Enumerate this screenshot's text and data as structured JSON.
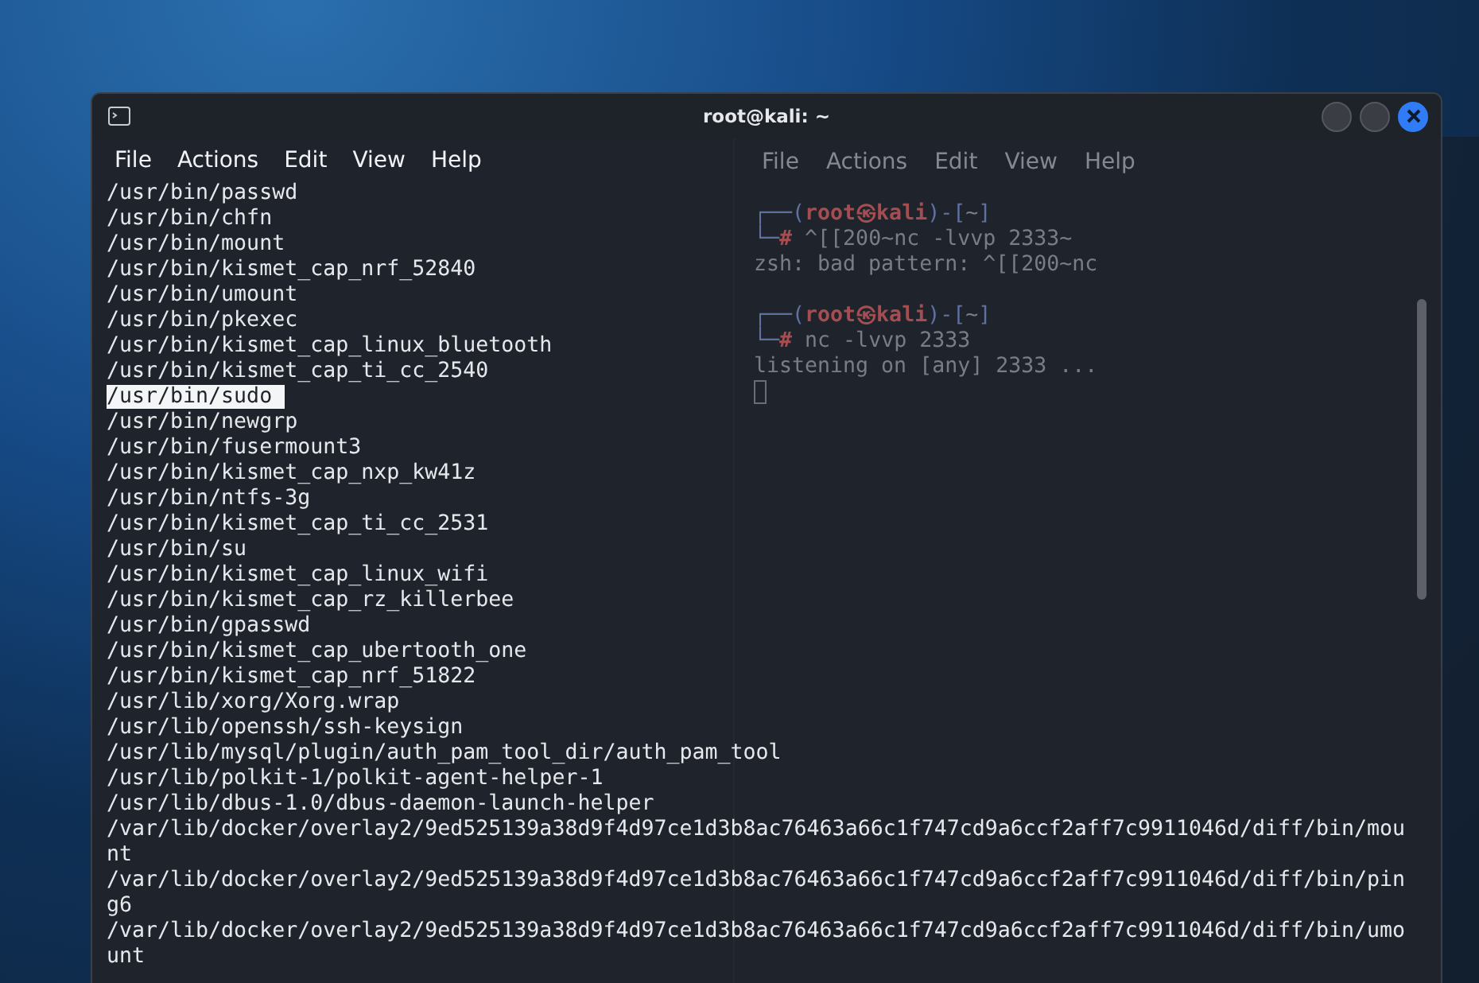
{
  "window": {
    "title": "root@kali: ~"
  },
  "menu": [
    "File",
    "Actions",
    "Edit",
    "View",
    "Help"
  ],
  "background_window": {
    "menu": [
      "File",
      "Actions",
      "Edit",
      "View",
      "Help"
    ],
    "lines": [
      {
        "parts": [
          {
            "text": "┌──(",
            "kind": "frame"
          },
          {
            "text": "root㉿kali",
            "kind": "user"
          },
          {
            "text": ")-[",
            "kind": "frame"
          },
          {
            "text": "~",
            "kind": "plain"
          },
          {
            "text": "]",
            "kind": "frame"
          }
        ]
      },
      {
        "parts": [
          {
            "text": "└─",
            "kind": "frame"
          },
          {
            "text": "#",
            "kind": "user"
          },
          {
            "text": " ^[[200~nc -lvvp 2333~",
            "kind": "plain"
          }
        ]
      },
      {
        "parts": [
          {
            "text": "zsh: bad pattern: ^[[200~nc",
            "kind": "plain"
          }
        ]
      },
      {
        "kind": "blank"
      },
      {
        "parts": [
          {
            "text": "┌──(",
            "kind": "frame"
          },
          {
            "text": "root㉿kali",
            "kind": "user"
          },
          {
            "text": ")-[",
            "kind": "frame"
          },
          {
            "text": "~",
            "kind": "plain"
          },
          {
            "text": "]",
            "kind": "frame"
          }
        ]
      },
      {
        "parts": [
          {
            "text": "└─",
            "kind": "frame"
          },
          {
            "text": "#",
            "kind": "user"
          },
          {
            "text": " nc -lvvp 2333",
            "kind": "plain"
          }
        ]
      },
      {
        "parts": [
          {
            "text": "listening on [any] 2333 ...",
            "kind": "plain"
          }
        ]
      }
    ]
  },
  "lines": [
    {
      "text": "/usr/bin/passwd",
      "selected": false
    },
    {
      "text": "/usr/bin/chfn",
      "selected": false
    },
    {
      "text": "/usr/bin/mount",
      "selected": false
    },
    {
      "text": "/usr/bin/kismet_cap_nrf_52840",
      "selected": false
    },
    {
      "text": "/usr/bin/umount",
      "selected": false
    },
    {
      "text": "/usr/bin/pkexec",
      "selected": false
    },
    {
      "text": "/usr/bin/kismet_cap_linux_bluetooth",
      "selected": false
    },
    {
      "text": "/usr/bin/kismet_cap_ti_cc_2540",
      "selected": false
    },
    {
      "text": "/usr/bin/sudo ",
      "selected": true
    },
    {
      "text": "/usr/bin/newgrp",
      "selected": false
    },
    {
      "text": "/usr/bin/fusermount3",
      "selected": false
    },
    {
      "text": "/usr/bin/kismet_cap_nxp_kw41z",
      "selected": false
    },
    {
      "text": "/usr/bin/ntfs-3g",
      "selected": false
    },
    {
      "text": "/usr/bin/kismet_cap_ti_cc_2531",
      "selected": false
    },
    {
      "text": "/usr/bin/su",
      "selected": false
    },
    {
      "text": "/usr/bin/kismet_cap_linux_wifi",
      "selected": false
    },
    {
      "text": "/usr/bin/kismet_cap_rz_killerbee",
      "selected": false
    },
    {
      "text": "/usr/bin/gpasswd",
      "selected": false
    },
    {
      "text": "/usr/bin/kismet_cap_ubertooth_one",
      "selected": false
    },
    {
      "text": "/usr/bin/kismet_cap_nrf_51822",
      "selected": false
    },
    {
      "text": "/usr/lib/xorg/Xorg.wrap",
      "selected": false
    },
    {
      "text": "/usr/lib/openssh/ssh-keysign",
      "selected": false
    },
    {
      "text": "/usr/lib/mysql/plugin/auth_pam_tool_dir/auth_pam_tool",
      "selected": false
    },
    {
      "text": "/usr/lib/polkit-1/polkit-agent-helper-1",
      "selected": false
    },
    {
      "text": "/usr/lib/dbus-1.0/dbus-daemon-launch-helper",
      "selected": false
    },
    {
      "text": "/var/lib/docker/overlay2/9ed525139a38d9f4d97ce1d3b8ac76463a66c1f747cd9a6ccf2aff7c9911046d/diff/bin/mou",
      "selected": false
    },
    {
      "text": "nt",
      "selected": false
    },
    {
      "text": "/var/lib/docker/overlay2/9ed525139a38d9f4d97ce1d3b8ac76463a66c1f747cd9a6ccf2aff7c9911046d/diff/bin/pin",
      "selected": false
    },
    {
      "text": "g6",
      "selected": false
    },
    {
      "text": "/var/lib/docker/overlay2/9ed525139a38d9f4d97ce1d3b8ac76463a66c1f747cd9a6ccf2aff7c9911046d/diff/bin/umo",
      "selected": false
    },
    {
      "text": "unt",
      "selected": false
    }
  ]
}
